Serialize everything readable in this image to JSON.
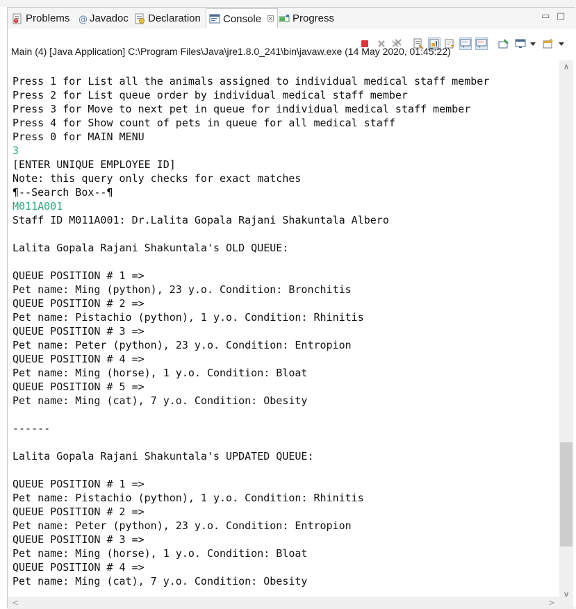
{
  "tabs": [
    {
      "label": "Problems",
      "icon": "problems-icon"
    },
    {
      "label": "Javadoc",
      "icon": "javadoc-icon"
    },
    {
      "label": "Declaration",
      "icon": "declaration-icon"
    },
    {
      "label": "Console",
      "icon": "console-icon",
      "active": true,
      "close": "☒"
    },
    {
      "label": "Progress",
      "icon": "progress-icon"
    }
  ],
  "window_controls": {
    "minimize": "▭",
    "maximize": "□"
  },
  "toolbar": {
    "icons": [
      "terminate-icon",
      "remove-launch-icon",
      "remove-all-launches-icon",
      "clear-console-icon",
      "scroll-lock-icon",
      "word-wrap-icon",
      "show-on-stdout-icon",
      "show-on-stderr-icon",
      "pin-console-icon",
      "display-console-icon",
      "display-console-menu-icon",
      "open-console-icon",
      "open-console-menu-icon"
    ]
  },
  "process_label": "Main (4) [Java Application] C:\\Program Files\\Java\\jre1.8.0_241\\bin\\javaw.exe (14 May 2020, 01:45:22)",
  "console_lines": [
    {
      "text": "Press 1 for List all the animals assigned to individual medical staff member",
      "type": "output"
    },
    {
      "text": "Press 2 for List queue order by individual medical staff member",
      "type": "output"
    },
    {
      "text": "Press 3 for Move to next pet in queue for individual medical staff member",
      "type": "output"
    },
    {
      "text": "Press 4 for Show count of pets in queue for all medical staff",
      "type": "output"
    },
    {
      "text": "Press 0 for MAIN MENU",
      "type": "output"
    },
    {
      "text": "3",
      "type": "input"
    },
    {
      "text": "[ENTER UNIQUE EMPLOYEE ID]",
      "type": "output"
    },
    {
      "text": "Note: this query only checks for exact matches",
      "type": "output"
    },
    {
      "text": "¶--Search Box--¶",
      "type": "output"
    },
    {
      "text": "M011A001",
      "type": "input"
    },
    {
      "text": "Staff ID M011A001: Dr.Lalita Gopala Rajani Shakuntala Albero",
      "type": "output"
    },
    {
      "text": "",
      "type": "output"
    },
    {
      "text": "Lalita Gopala Rajani Shakuntala's OLD QUEUE:",
      "type": "output"
    },
    {
      "text": "",
      "type": "output"
    },
    {
      "text": "QUEUE POSITION # 1 =>",
      "type": "output"
    },
    {
      "text": "Pet name: Ming (python), 23 y.o. Condition: Bronchitis",
      "type": "output"
    },
    {
      "text": "QUEUE POSITION # 2 =>",
      "type": "output"
    },
    {
      "text": "Pet name: Pistachio (python), 1 y.o. Condition: Rhinitis",
      "type": "output"
    },
    {
      "text": "QUEUE POSITION # 3 =>",
      "type": "output"
    },
    {
      "text": "Pet name: Peter (python), 23 y.o. Condition: Entropion",
      "type": "output"
    },
    {
      "text": "QUEUE POSITION # 4 =>",
      "type": "output"
    },
    {
      "text": "Pet name: Ming (horse), 1 y.o. Condition: Bloat",
      "type": "output"
    },
    {
      "text": "QUEUE POSITION # 5 =>",
      "type": "output"
    },
    {
      "text": "Pet name: Ming (cat), 7 y.o. Condition: Obesity",
      "type": "output"
    },
    {
      "text": "",
      "type": "output"
    },
    {
      "text": "------",
      "type": "output"
    },
    {
      "text": "",
      "type": "output"
    },
    {
      "text": "Lalita Gopala Rajani Shakuntala's UPDATED QUEUE:",
      "type": "output"
    },
    {
      "text": "",
      "type": "output"
    },
    {
      "text": "QUEUE POSITION # 1 =>",
      "type": "output"
    },
    {
      "text": "Pet name: Pistachio (python), 1 y.o. Condition: Rhinitis",
      "type": "output"
    },
    {
      "text": "QUEUE POSITION # 2 =>",
      "type": "output"
    },
    {
      "text": "Pet name: Peter (python), 23 y.o. Condition: Entropion",
      "type": "output"
    },
    {
      "text": "QUEUE POSITION # 3 =>",
      "type": "output"
    },
    {
      "text": "Pet name: Ming (horse), 1 y.o. Condition: Bloat",
      "type": "output"
    },
    {
      "text": "QUEUE POSITION # 4 =>",
      "type": "output"
    },
    {
      "text": "Pet name: Ming (cat), 7 y.o. Condition: Obesity",
      "type": "output"
    }
  ],
  "colors": {
    "input_text": "#2aa87a",
    "output_text": "#111111",
    "terminate": "#e0323a"
  },
  "scroll_arrows": {
    "up": "∧",
    "down": "∨",
    "left": "<",
    "right": ">"
  }
}
